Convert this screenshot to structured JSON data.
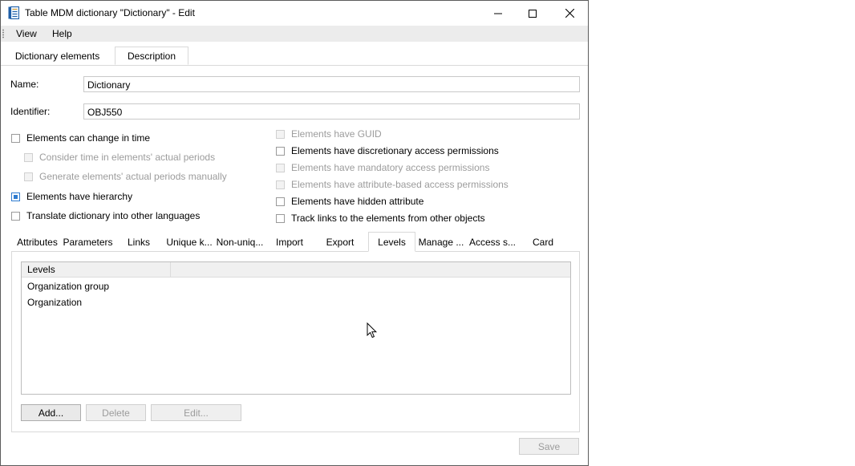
{
  "window": {
    "title": "Table MDM dictionary \"Dictionary\" - Edit"
  },
  "menu": {
    "items": [
      {
        "label": "View"
      },
      {
        "label": "Help"
      }
    ]
  },
  "top_tabs": [
    {
      "label": "Dictionary elements",
      "active": false
    },
    {
      "label": "Description",
      "active": true
    }
  ],
  "form": {
    "name_label": "Name:",
    "name_value": "Dictionary",
    "identifier_label": "Identifier:",
    "identifier_value": "OBJ550"
  },
  "options_left": [
    {
      "label": "Elements can change in time",
      "checked": false,
      "disabled": false
    },
    {
      "label": "Consider time in elements' actual periods",
      "checked": false,
      "disabled": true
    },
    {
      "label": "Generate elements' actual periods manually",
      "checked": false,
      "disabled": true
    },
    {
      "label": "Elements have hierarchy",
      "checked": true,
      "disabled": false
    },
    {
      "label": "Translate dictionary into other languages",
      "checked": false,
      "disabled": false
    }
  ],
  "options_right": [
    {
      "label": "Elements have GUID",
      "checked": false,
      "disabled": true
    },
    {
      "label": "Elements have discretionary access permissions",
      "checked": false,
      "disabled": false
    },
    {
      "label": "Elements have mandatory access permissions",
      "checked": false,
      "disabled": true
    },
    {
      "label": "Elements have attribute-based access permissions",
      "checked": false,
      "disabled": true
    },
    {
      "label": "Elements have hidden attribute",
      "checked": false,
      "disabled": false
    },
    {
      "label": "Track links to the elements from other objects",
      "checked": false,
      "disabled": false
    }
  ],
  "bottom_tabs": [
    {
      "label": "Attributes",
      "active": false
    },
    {
      "label": "Parameters",
      "active": false
    },
    {
      "label": "Links",
      "active": false
    },
    {
      "label": "Unique k...",
      "active": false
    },
    {
      "label": "Non-uniq...",
      "active": false
    },
    {
      "label": "Import",
      "active": false
    },
    {
      "label": "Export",
      "active": false
    },
    {
      "label": "Levels",
      "active": true
    },
    {
      "label": "Manage ...",
      "active": false
    },
    {
      "label": "Access s...",
      "active": false
    },
    {
      "label": "Card",
      "active": false
    }
  ],
  "levels_grid": {
    "header": "Levels",
    "rows": [
      "Organization group",
      "Organization"
    ]
  },
  "levels_buttons": {
    "add": "Add...",
    "delete": "Delete",
    "edit": "Edit..."
  },
  "footer": {
    "save": "Save"
  },
  "colors": {
    "accent": "#2f7cd0",
    "menubar": "#ececec"
  }
}
